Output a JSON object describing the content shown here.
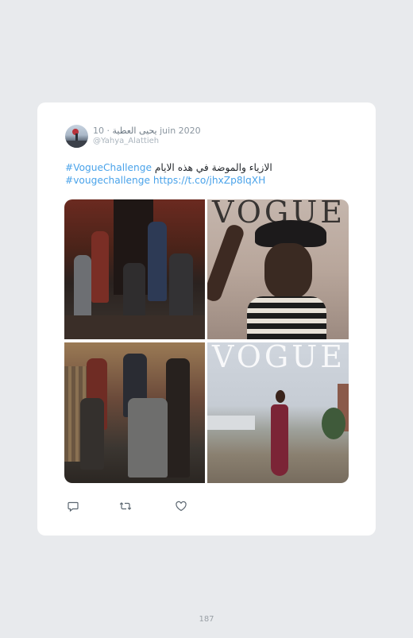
{
  "tweet": {
    "display_name": "يحيى العطية",
    "date": " · 10 juin 2020",
    "handle": "@Yahya_Alattieh",
    "hashtag1": "#VogueChallenge",
    "arabic_text": " الازياء والموضة في هذه الايام",
    "hashtag2": "#vougechallenge",
    "link": " https://t.co/jhxZp8lqXH"
  },
  "media": {
    "images": [
      {
        "description_icon": "group-photo-icon"
      },
      {
        "description_icon": "vogue-cover-icon"
      },
      {
        "description_icon": "group-photo-icon"
      },
      {
        "description_icon": "vogue-cover-icon"
      }
    ],
    "vogue_label": "VOGUE"
  },
  "actions": {
    "reply_icon": "reply-icon",
    "retweet_icon": "retweet-icon",
    "like_icon": "like-icon"
  },
  "page": {
    "number": "187"
  }
}
